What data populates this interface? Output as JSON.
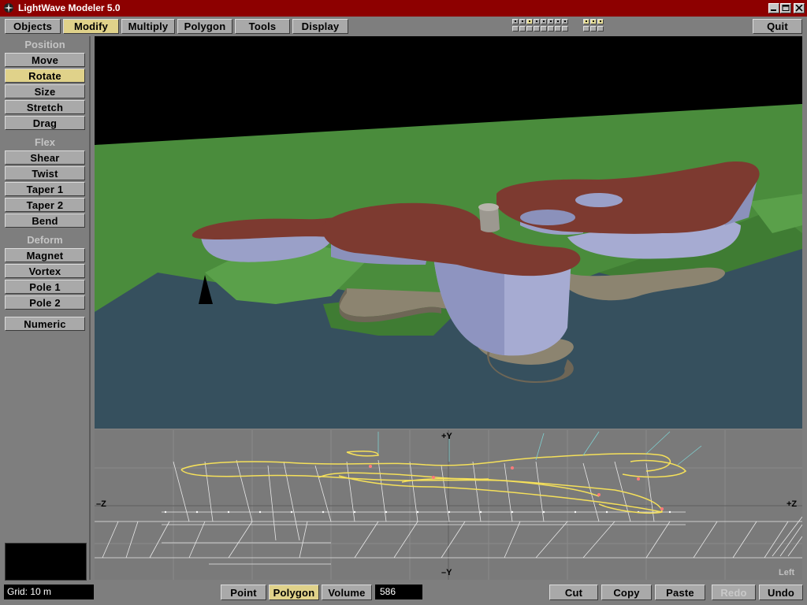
{
  "window": {
    "title": "LightWave Modeler 5.0"
  },
  "menu": {
    "tabs": [
      {
        "label": "Objects",
        "active": false
      },
      {
        "label": "Modify",
        "active": true
      },
      {
        "label": "Multiply",
        "active": false
      },
      {
        "label": "Polygon",
        "active": false
      },
      {
        "label": "Tools",
        "active": false
      },
      {
        "label": "Display",
        "active": false
      }
    ],
    "quit_label": "Quit"
  },
  "sidebar": {
    "sections": [
      {
        "title": "Position",
        "items": [
          {
            "label": "Move",
            "active": false
          },
          {
            "label": "Rotate",
            "active": true
          },
          {
            "label": "Size",
            "active": false
          },
          {
            "label": "Stretch",
            "active": false
          },
          {
            "label": "Drag",
            "active": false
          }
        ]
      },
      {
        "title": "Flex",
        "items": [
          {
            "label": "Shear",
            "active": false
          },
          {
            "label": "Twist",
            "active": false
          },
          {
            "label": "Taper 1",
            "active": false
          },
          {
            "label": "Taper 2",
            "active": false
          },
          {
            "label": "Bend",
            "active": false
          }
        ]
      },
      {
        "title": "Deform",
        "items": [
          {
            "label": "Magnet",
            "active": false
          },
          {
            "label": "Vortex",
            "active": false
          },
          {
            "label": "Pole 1",
            "active": false
          },
          {
            "label": "Pole 2",
            "active": false
          }
        ]
      }
    ],
    "numeric_label": "Numeric"
  },
  "viewport_side": {
    "axis_top": "+Y",
    "axis_bottom": "–Y",
    "axis_left": "–Z",
    "axis_right": "+Z",
    "view_name": "Left"
  },
  "status": {
    "grid": "Grid: 10 m",
    "select_modes": [
      {
        "label": "Point",
        "active": false
      },
      {
        "label": "Polygon",
        "active": true
      },
      {
        "label": "Volume",
        "active": false
      }
    ],
    "selection_count": "586",
    "edit_buttons": [
      {
        "label": "Cut",
        "enabled": true
      },
      {
        "label": "Copy",
        "enabled": true
      },
      {
        "label": "Paste",
        "enabled": true
      },
      {
        "label": "Redo",
        "enabled": false
      },
      {
        "label": "Undo",
        "enabled": true
      }
    ]
  },
  "colors": {
    "titlebar": "#8d0000",
    "active_button": "#e0d28a",
    "button": "#a9a9a9",
    "roof": "#7d3a30",
    "walls": "#9aa0c8",
    "ground": "#4a8c3c",
    "water": "#36505e",
    "wireframe_selected": "#f5e05a"
  }
}
